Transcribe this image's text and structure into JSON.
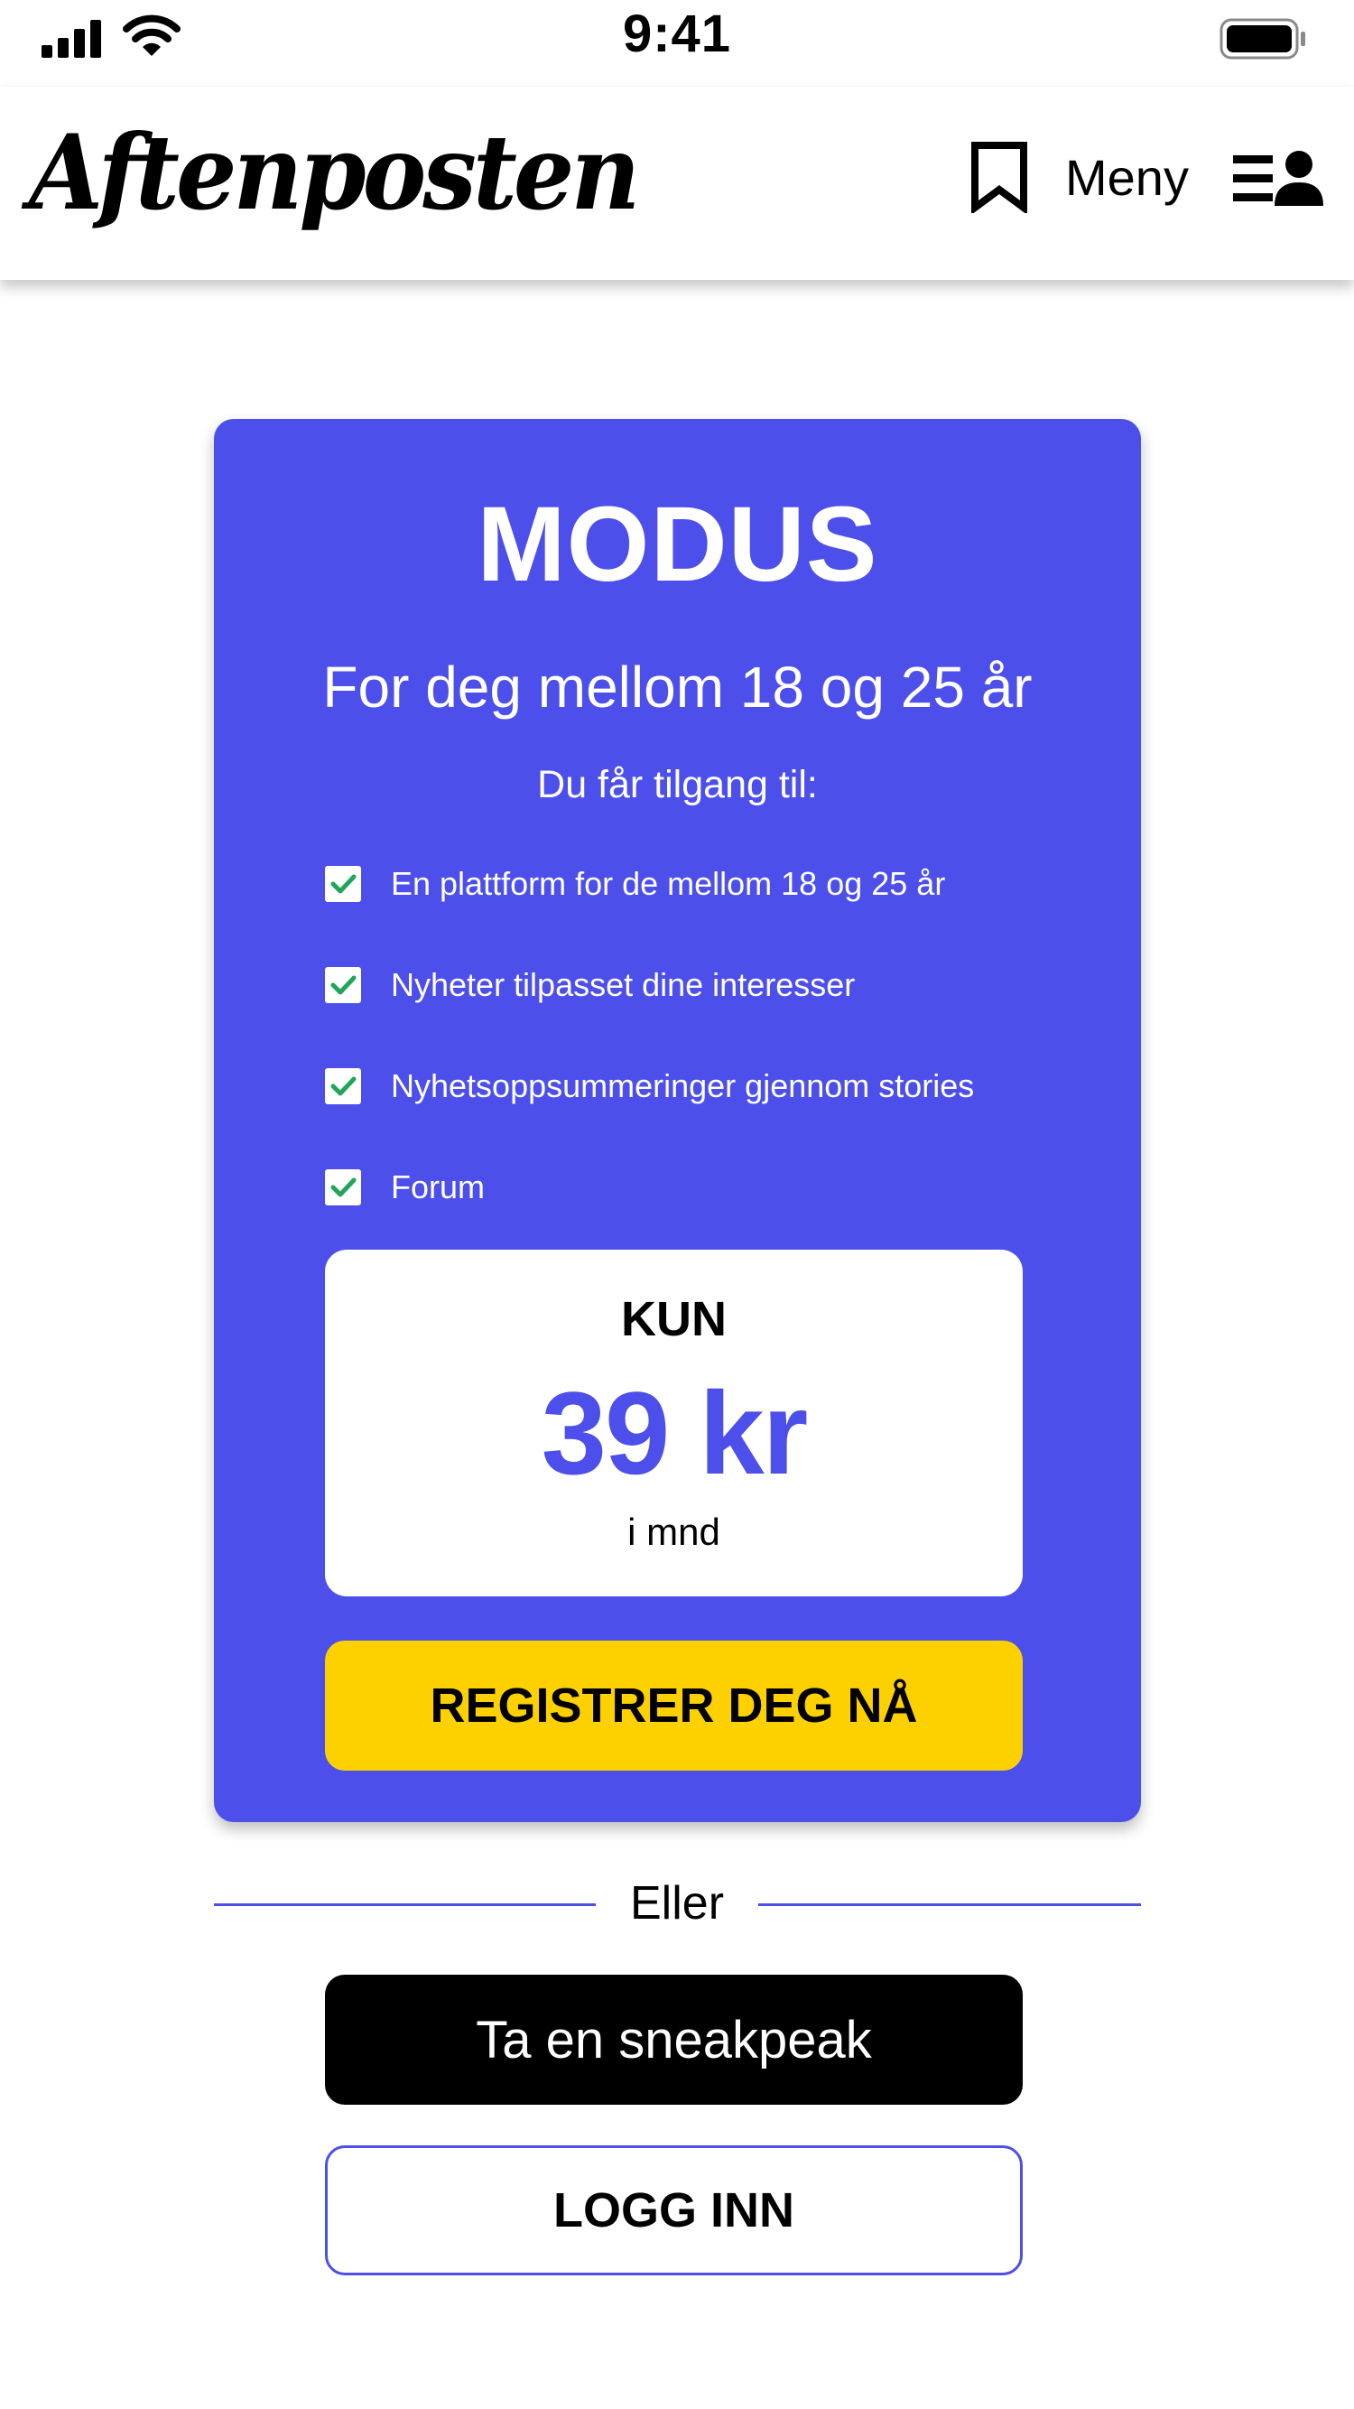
{
  "status_bar": {
    "time": "9:41",
    "icons": [
      "cellular-signal-icon",
      "wifi-icon",
      "battery-icon"
    ]
  },
  "header": {
    "logo_text": "Aftenposten",
    "menu_label": "Meny",
    "icons": [
      "bookmark-icon",
      "profile-list-icon"
    ]
  },
  "card": {
    "title": "MODUS",
    "subtitle": "For deg mellom 18 og 25 år",
    "access_text": "Du får tilgang til:",
    "features": [
      {
        "label": "En plattform for de mellom 18 og 25 år",
        "checked": true
      },
      {
        "label": "Nyheter tilpasset dine interesser",
        "checked": true
      },
      {
        "label": "Nyhetsoppsummeringer gjennom stories",
        "checked": true
      },
      {
        "label": "Forum",
        "checked": true
      }
    ],
    "price": {
      "prefix": "KUN",
      "amount": "39 kr",
      "period": "i mnd"
    },
    "register_label": "REGISTRER DEG NÅ"
  },
  "divider_label": "Eller",
  "sneakpeek_label": "Ta en sneakpeak",
  "login_label": "LOGG INN",
  "colors": {
    "accent": "#4d4feb",
    "cta_yellow": "#fdd100",
    "check_green": "#22a55a",
    "black": "#000000",
    "white": "#ffffff"
  }
}
